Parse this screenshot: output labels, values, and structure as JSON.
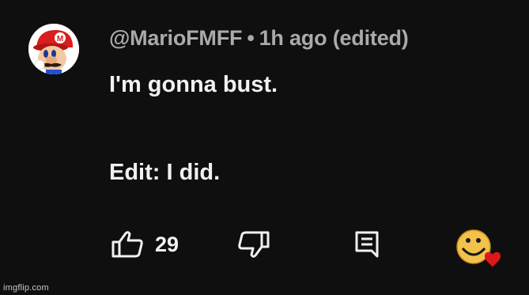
{
  "comment": {
    "author": "@MarioFMFF",
    "separator": "•",
    "time": "1h ago",
    "edited": "(edited)",
    "text_line1": "I'm gonna bust.",
    "text_line2": "Edit: I did.",
    "avatar_icon": "mario-avatar"
  },
  "actions": {
    "like_icon": "thumbs-up-icon",
    "like_count": "29",
    "dislike_icon": "thumbs-down-icon",
    "reply_icon": "comment-reply-icon",
    "creator_heart_icon": "creator-heart-icon"
  },
  "watermark": "imgflip.com",
  "colors": {
    "background": "#0f0f0f",
    "primary_text": "#f1f1f1",
    "secondary_text": "#aaaaaa",
    "heart": "#e0161b"
  }
}
